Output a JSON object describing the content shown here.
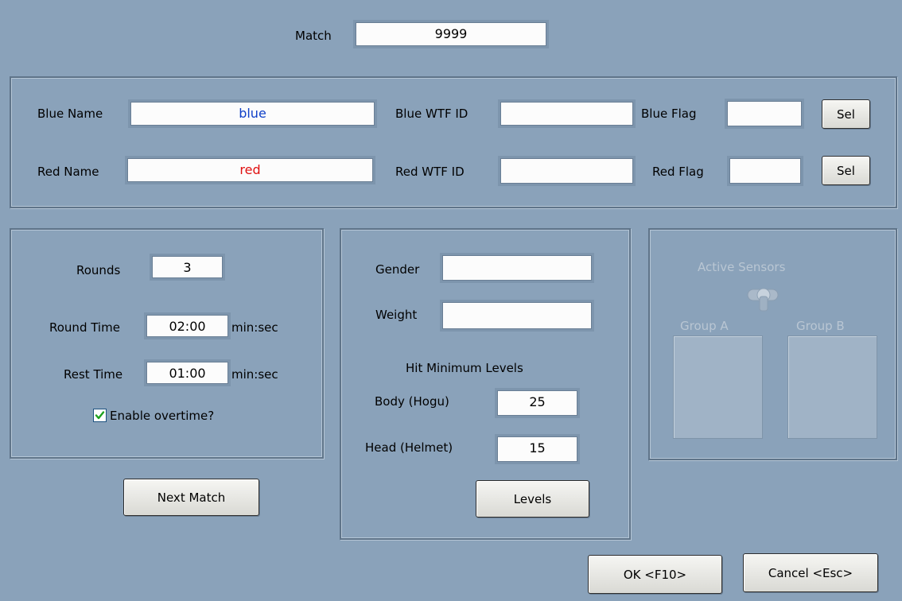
{
  "match": {
    "label": "Match",
    "value": "9999"
  },
  "competitors": {
    "blue_name_label": "Blue Name",
    "blue_name_value": "blue",
    "blue_name_color": "#1040c8",
    "blue_wtf_label": "Blue WTF ID",
    "blue_wtf_value": "",
    "blue_flag_label": "Blue Flag",
    "blue_flag_value": "",
    "red_name_label": "Red Name",
    "red_name_value": "red",
    "red_name_color": "#e01010",
    "red_wtf_label": "Red WTF ID",
    "red_wtf_value": "",
    "red_flag_label": "Red Flag",
    "red_flag_value": "",
    "sel_label": "Sel"
  },
  "timing": {
    "rounds_label": "Rounds",
    "rounds_value": "3",
    "round_time_label": "Round Time",
    "round_time_value": "02:00",
    "rest_time_label": "Rest Time",
    "rest_time_value": "01:00",
    "unit_label": "min:sec",
    "overtime_label": "Enable overtime?",
    "overtime_checked": true
  },
  "category": {
    "gender_label": "Gender",
    "gender_value": "",
    "weight_label": "Weight",
    "weight_value": "",
    "hit_min_label": "Hit Minimum Levels",
    "body_label": "Body (Hogu)",
    "body_value": "25",
    "head_label": "Head (Helmet)",
    "head_value": "15",
    "levels_button": "Levels"
  },
  "sensors": {
    "title": "Active Sensors",
    "group_a_label": "Group A",
    "group_b_label": "Group B"
  },
  "buttons": {
    "next_match": "Next Match",
    "ok": "OK <F10>",
    "cancel": "Cancel <Esc>"
  }
}
